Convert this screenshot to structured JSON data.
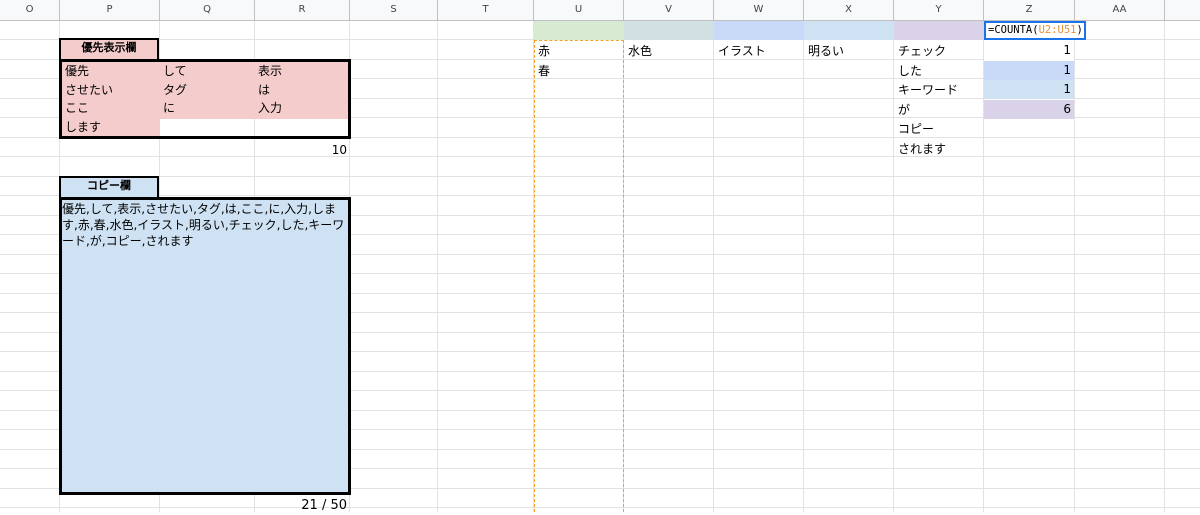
{
  "columns": [
    "O",
    "P",
    "Q",
    "R",
    "S",
    "T",
    "U",
    "V",
    "W",
    "X",
    "Y",
    "Z",
    "AA"
  ],
  "formula": {
    "prefix": "=COUNTA(",
    "range": "U2:U51",
    "suffix": ")"
  },
  "priority": {
    "title": "優先表示欄",
    "cells": [
      [
        "優先",
        "して",
        "表示"
      ],
      [
        "させたい",
        "タグ",
        "は"
      ],
      [
        "ここ",
        "に",
        "入力"
      ],
      [
        "します",
        "",
        ""
      ]
    ],
    "count": "10"
  },
  "copy": {
    "title": "コピー欄",
    "text": "優先,して,表示,させたい,タグ,は,ここ,に,入力,します,赤,春,水色,イラスト,明るい,チェック,した,キーワード,が,コピー,されます",
    "count": "21 / 50"
  },
  "tags": {
    "u": [
      "赤",
      "春"
    ],
    "v": [
      "水色"
    ],
    "w": [
      "イラスト"
    ],
    "x": [
      "明るい"
    ],
    "y": [
      "チェック",
      "した",
      "キーワード",
      "が",
      "コピー",
      "されます"
    ],
    "z": [
      "1",
      "1",
      "1",
      "6"
    ]
  },
  "colors": {
    "u_header": "#d9ead3",
    "v_header": "#d0e0e3",
    "w_header": "#c9daf8",
    "x_header": "#cfe2f3",
    "y_header": "#d9d2e9",
    "z1": "#ffffff",
    "z2": "#c9daf8",
    "z3": "#cfe2f3",
    "z4": "#d9d2e9"
  }
}
